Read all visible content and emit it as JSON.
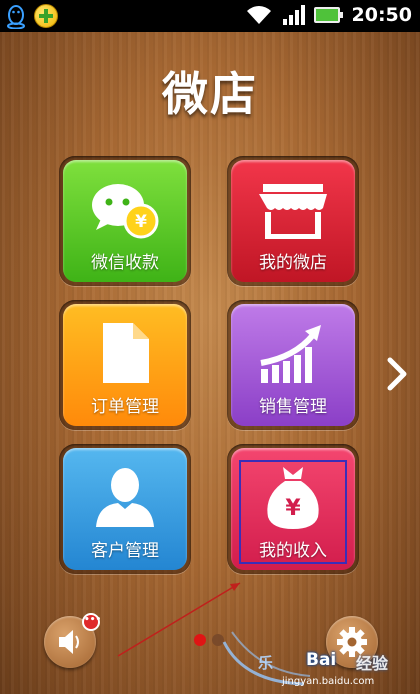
{
  "status_bar": {
    "time": "20:50",
    "left_icons": [
      "qq-penguin-icon",
      "plus-circle-icon"
    ],
    "right_icons": [
      "wifi-icon",
      "signal-icon",
      "battery-icon"
    ]
  },
  "app": {
    "title": "微店"
  },
  "tiles": [
    {
      "label": "微信收款",
      "icon": "wechat-pay-icon",
      "color": "#52c425"
    },
    {
      "label": "我的微店",
      "icon": "shop-icon",
      "color": "#d9202f"
    },
    {
      "label": "订单管理",
      "icon": "document-icon",
      "color": "#ffa31a"
    },
    {
      "label": "销售管理",
      "icon": "growth-chart-icon",
      "color": "#a45bd8"
    },
    {
      "label": "客户管理",
      "icon": "user-icon",
      "color": "#3c9fe2"
    },
    {
      "label": "我的收入",
      "icon": "money-bag-icon",
      "color": "#e2305c"
    }
  ],
  "navigation": {
    "next_icon": "chevron-right-icon"
  },
  "bottom": {
    "left_icon": "speaker-icon",
    "badge_text": "•••",
    "right_icon": "gear-icon"
  },
  "watermark": {
    "text": "经验",
    "brand": "Bai",
    "brand_prefix": "乐",
    "url": "jingyan.baidu.com"
  }
}
